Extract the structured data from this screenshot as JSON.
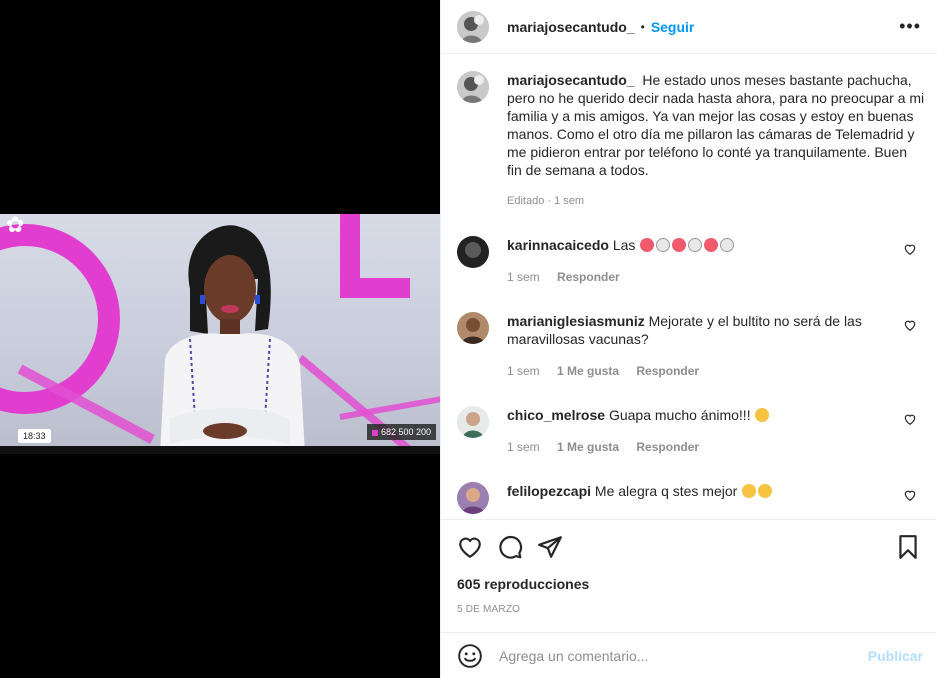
{
  "post": {
    "username": "mariajosecantudo_",
    "follow_label": "Seguir",
    "separator": "•",
    "more_label": "•••"
  },
  "media": {
    "clock_text": "18:33",
    "phone_text": "682 500 200"
  },
  "caption": {
    "username": "mariajosecantudo_",
    "text": "He estado unos meses bastante pachucha, pero no he querido decir nada hasta ahora, para no preocupar a mi familia y a mis amigos. Ya van mejor las cosas y estoy en buenas manos. Como el otro día me pillaron las cámaras de Telemadrid y me pidieron entrar por teléfono lo conté ya tranquilamente. Buen fin de semana a todos.",
    "meta": "Editado · 1 sem"
  },
  "comments": [
    {
      "username": "karinnacaicedo",
      "text": "Las",
      "time": "1 sem",
      "likes": "",
      "reply": "Responder"
    },
    {
      "username": "marianiglesiasmuniz",
      "text": "Mejorate y el bultito no será de las maravillosas vacunas?",
      "time": "1 sem",
      "likes": "1 Me gusta",
      "reply": "Responder"
    },
    {
      "username": "chico_melrose",
      "text": "Guapa mucho ánimo!!!",
      "time": "1 sem",
      "likes": "1 Me gusta",
      "reply": "Responder"
    },
    {
      "username": "felilopezcapi",
      "text": "Me alegra q stes mejor",
      "time": "",
      "likes": "",
      "reply": ""
    }
  ],
  "stats": {
    "views": "605 reproducciones",
    "date": "5 DE MARZO"
  },
  "composer": {
    "placeholder": "Agrega un comentario...",
    "publish_label": "Publicar"
  },
  "colors": {
    "link": "#0095f6",
    "publish_disabled": "#b2dffc",
    "muted": "#8e8e8e",
    "tv_accent": "#e13ed0"
  }
}
